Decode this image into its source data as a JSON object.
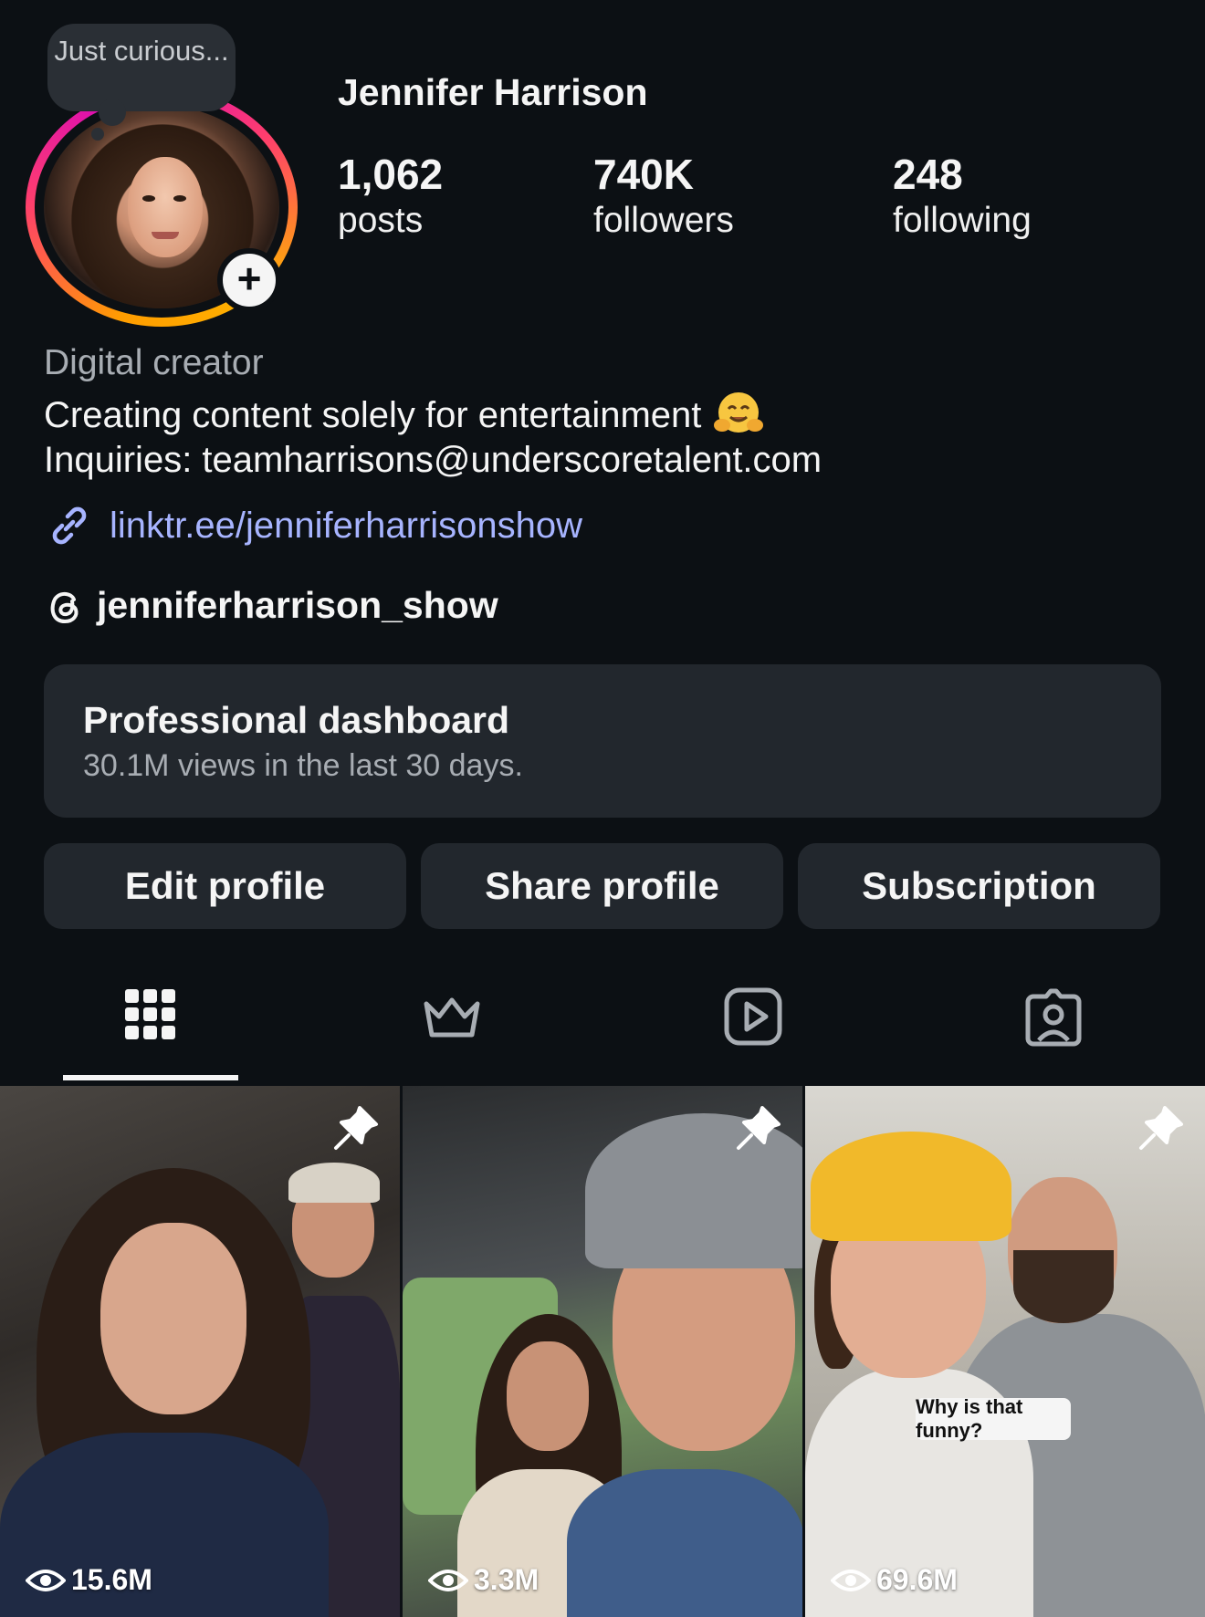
{
  "profile": {
    "note": "Just curious...",
    "display_name": "Jennifer Harrison",
    "stats": [
      {
        "value": "1,062",
        "label": "posts"
      },
      {
        "value": "740K",
        "label": "followers"
      },
      {
        "value": "248",
        "label": "following"
      }
    ],
    "category": "Digital creator",
    "bio": [
      "Creating content solely for entertainment",
      "Inquiries: teamharrisons@underscoretalent.com"
    ],
    "link": "linktr.ee/jenniferharrisonshow",
    "threads_handle": "jenniferharrison_show"
  },
  "dashboard": {
    "title": "Professional dashboard",
    "subtitle": "30.1M views in the last 30 days."
  },
  "buttons": {
    "edit": "Edit profile",
    "share": "Share profile",
    "subscription": "Subscription"
  },
  "tabs": [
    {
      "icon": "grid-icon",
      "active": true
    },
    {
      "icon": "crown-icon",
      "active": false
    },
    {
      "icon": "reels-icon",
      "active": false
    },
    {
      "icon": "tagged-icon",
      "active": false
    }
  ],
  "posts": [
    {
      "views": "15.6M",
      "pinned": true
    },
    {
      "views": "3.3M",
      "pinned": true
    },
    {
      "views": "69.6M",
      "pinned": true,
      "caption": "Why is that funny?"
    }
  ],
  "colors": {
    "background": "#0c1014",
    "card": "#22272d",
    "link": "#a7b4ff",
    "muted": "#a8adb3"
  }
}
